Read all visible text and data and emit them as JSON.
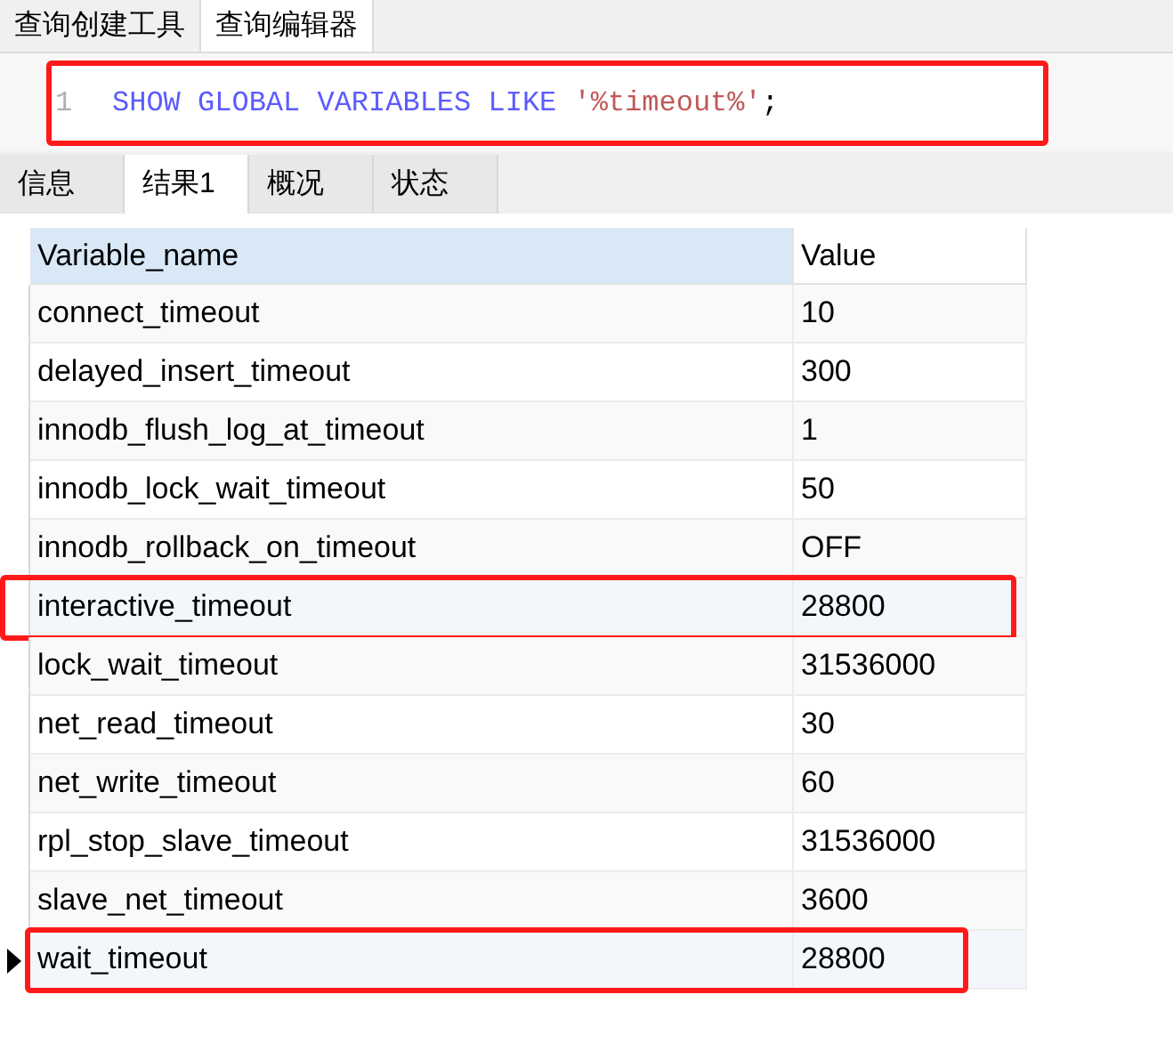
{
  "top_tabs": [
    {
      "label": "查询创建工具",
      "selected": false
    },
    {
      "label": "查询编辑器",
      "selected": true
    }
  ],
  "editor": {
    "annotated": true,
    "lines": [
      {
        "number": "1",
        "tokens": [
          {
            "kind": "keyword",
            "text": "SHOW GLOBAL VARIABLES LIKE"
          },
          {
            "kind": "string",
            "text": "'%timeout%'"
          },
          {
            "kind": "punct",
            "text": ";"
          }
        ]
      }
    ]
  },
  "result_tabs": [
    {
      "label": "信息",
      "selected": false
    },
    {
      "label": "结果1",
      "selected": true
    },
    {
      "label": "概况",
      "selected": false
    },
    {
      "label": "状态",
      "selected": false
    }
  ],
  "table": {
    "columns": [
      "Variable_name",
      "Value"
    ],
    "rows": [
      {
        "cells": [
          "connect_timeout",
          "10"
        ],
        "selected": false,
        "annotated": false
      },
      {
        "cells": [
          "delayed_insert_timeout",
          "300"
        ],
        "selected": false,
        "annotated": false
      },
      {
        "cells": [
          "innodb_flush_log_at_timeout",
          "1"
        ],
        "selected": false,
        "annotated": false
      },
      {
        "cells": [
          "innodb_lock_wait_timeout",
          "50"
        ],
        "selected": false,
        "annotated": false
      },
      {
        "cells": [
          "innodb_rollback_on_timeout",
          "OFF"
        ],
        "selected": false,
        "annotated": false
      },
      {
        "cells": [
          "interactive_timeout",
          "28800"
        ],
        "selected": false,
        "annotated": true
      },
      {
        "cells": [
          "lock_wait_timeout",
          "31536000"
        ],
        "selected": false,
        "annotated": false
      },
      {
        "cells": [
          "net_read_timeout",
          "30"
        ],
        "selected": false,
        "annotated": false
      },
      {
        "cells": [
          "net_write_timeout",
          "60"
        ],
        "selected": false,
        "annotated": false
      },
      {
        "cells": [
          "rpl_stop_slave_timeout",
          "31536000"
        ],
        "selected": false,
        "annotated": false
      },
      {
        "cells": [
          "slave_net_timeout",
          "3600"
        ],
        "selected": false,
        "annotated": false
      },
      {
        "cells": [
          "wait_timeout",
          "28800"
        ],
        "selected": true,
        "annotated": true
      }
    ]
  }
}
